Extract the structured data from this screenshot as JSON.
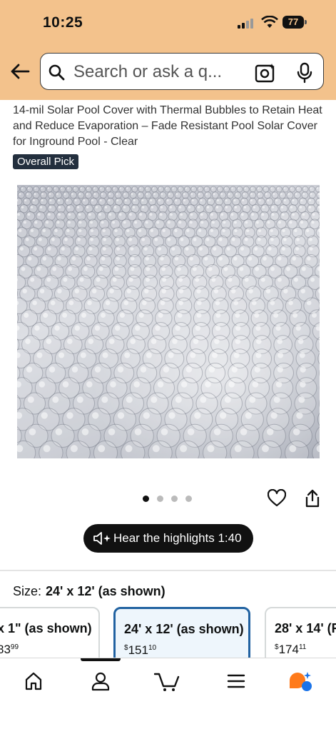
{
  "status": {
    "time": "10:25",
    "battery": "77"
  },
  "search": {
    "placeholder": "Search or ask a q..."
  },
  "product": {
    "title": "14-mil Solar Pool Cover with Thermal Bubbles to Retain Heat and Reduce Evaporation – Fade Resistant Pool Solar Cover for Inground Pool - Clear",
    "badge": "Overall Pick",
    "image_count": 4,
    "active_image": 1
  },
  "highlights": {
    "label": "Hear the highlights 1:40"
  },
  "size": {
    "label": "Size:",
    "selected": "24' x 12' (as shown)",
    "options": [
      {
        "name": "x 1\" (as shown)",
        "price_whole": "83",
        "price_cents": "99",
        "currency": ""
      },
      {
        "name": "24' x 12' (as shown)",
        "price_whole": "151",
        "price_cents": "10",
        "currency": "$"
      },
      {
        "name": "28' x 14' (R",
        "price_whole": "174",
        "price_cents": "11",
        "currency": "$"
      }
    ]
  },
  "tabs": [
    "home-icon",
    "account-icon",
    "cart-icon",
    "menu-icon",
    "rufus-icon"
  ],
  "colors": {
    "header": "#f3c28c",
    "badge": "#232f3e",
    "selected_border": "#2162a1"
  }
}
